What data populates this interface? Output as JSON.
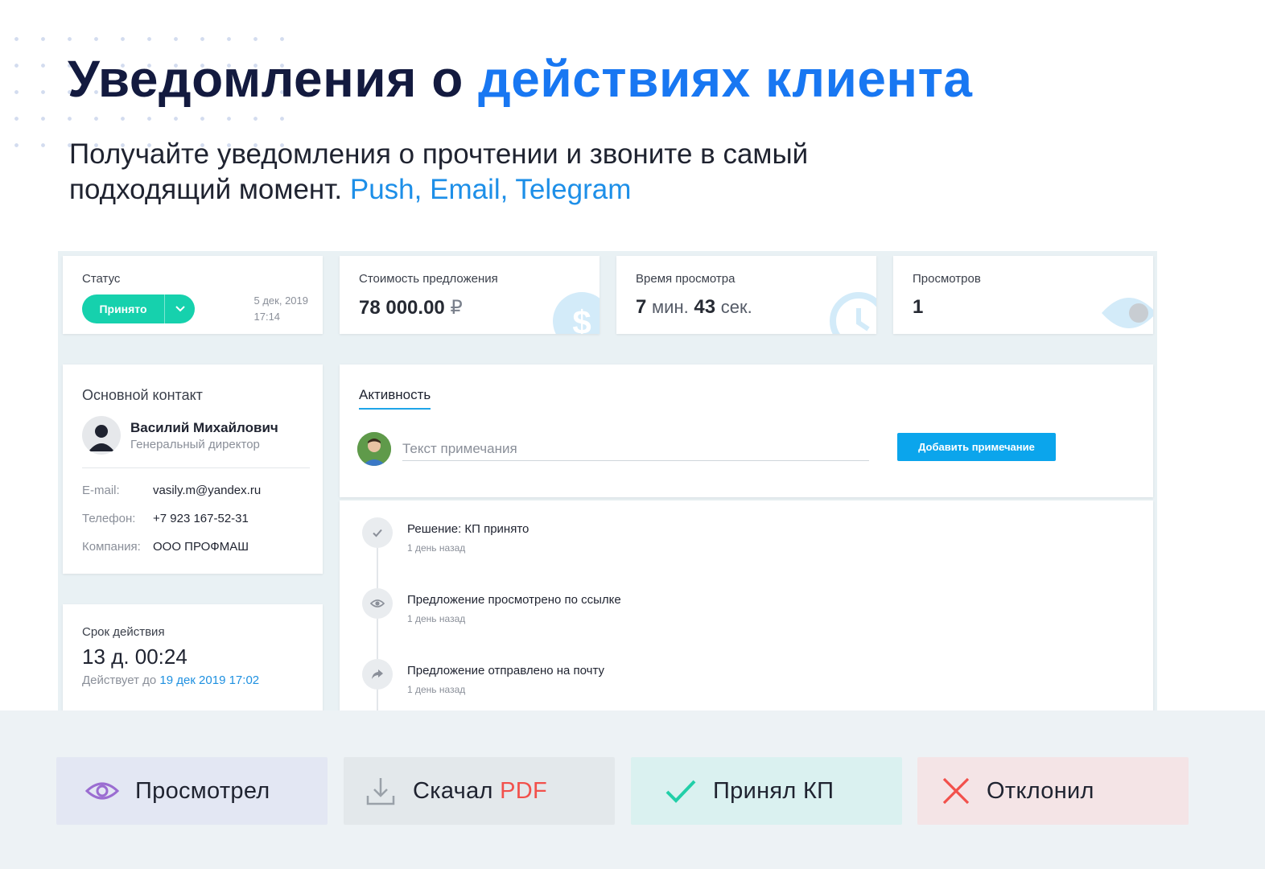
{
  "hero": {
    "title_main": "Уведомления о",
    "title_accent": "действиях клиента",
    "subtitle_line1": "Получайте уведомления о прочтении и звоните в самый",
    "subtitle_line2": "подходящий момент.",
    "subtitle_channels": "Push, Email, Telegram"
  },
  "stats": {
    "status": {
      "label": "Статус",
      "button": "Принято",
      "date": "5 дек, 2019",
      "time": "17:14"
    },
    "price": {
      "label": "Стоимость предложения",
      "value": "78 000.00",
      "currency": "₽"
    },
    "view_time": {
      "label": "Время просмотра",
      "minutes": "7",
      "minutes_unit": "мин.",
      "seconds": "43",
      "seconds_unit": "сек."
    },
    "views": {
      "label": "Просмотров",
      "value": "1"
    }
  },
  "contact": {
    "title": "Основной контакт",
    "name": "Василий Михайлович",
    "role": "Генеральный директор",
    "email_label": "E-mail:",
    "email": "vasily.m@yandex.ru",
    "phone_label": "Телефон:",
    "phone": "+7 923 167-52-31",
    "company_label": "Компания:",
    "company": "ООО ПРОФМАШ"
  },
  "validity": {
    "label": "Срок действия",
    "value": "13 д. 00:24",
    "note_prefix": "Действует до",
    "note_date": "19 дек 2019 17:02"
  },
  "activity": {
    "tab": "Активность",
    "note_placeholder": "Текст примечания",
    "add_button": "Добавить примечание",
    "events": [
      {
        "title": "Решение: КП принято",
        "time": "1 день назад",
        "icon": "check-icon"
      },
      {
        "title": "Предложение просмотрено по ссылке",
        "time": "1 день назад",
        "icon": "eye-icon"
      },
      {
        "title": "Предложение отправлено на почту",
        "time": "1 день назад",
        "icon": "share-arrow-icon"
      }
    ]
  },
  "badges": {
    "viewed": "Просмотрел",
    "downloaded": "Скачал",
    "downloaded_pdf": "PDF",
    "accepted": "Принял КП",
    "declined": "Отклонил"
  },
  "colors": {
    "accent_blue": "#1877f2",
    "status_green": "#16d1ad",
    "button_blue": "#0ba5ec",
    "viewed_purple": "#9b6dd1",
    "accepted_teal": "#22cfa8",
    "declined_red": "#f2504b"
  }
}
